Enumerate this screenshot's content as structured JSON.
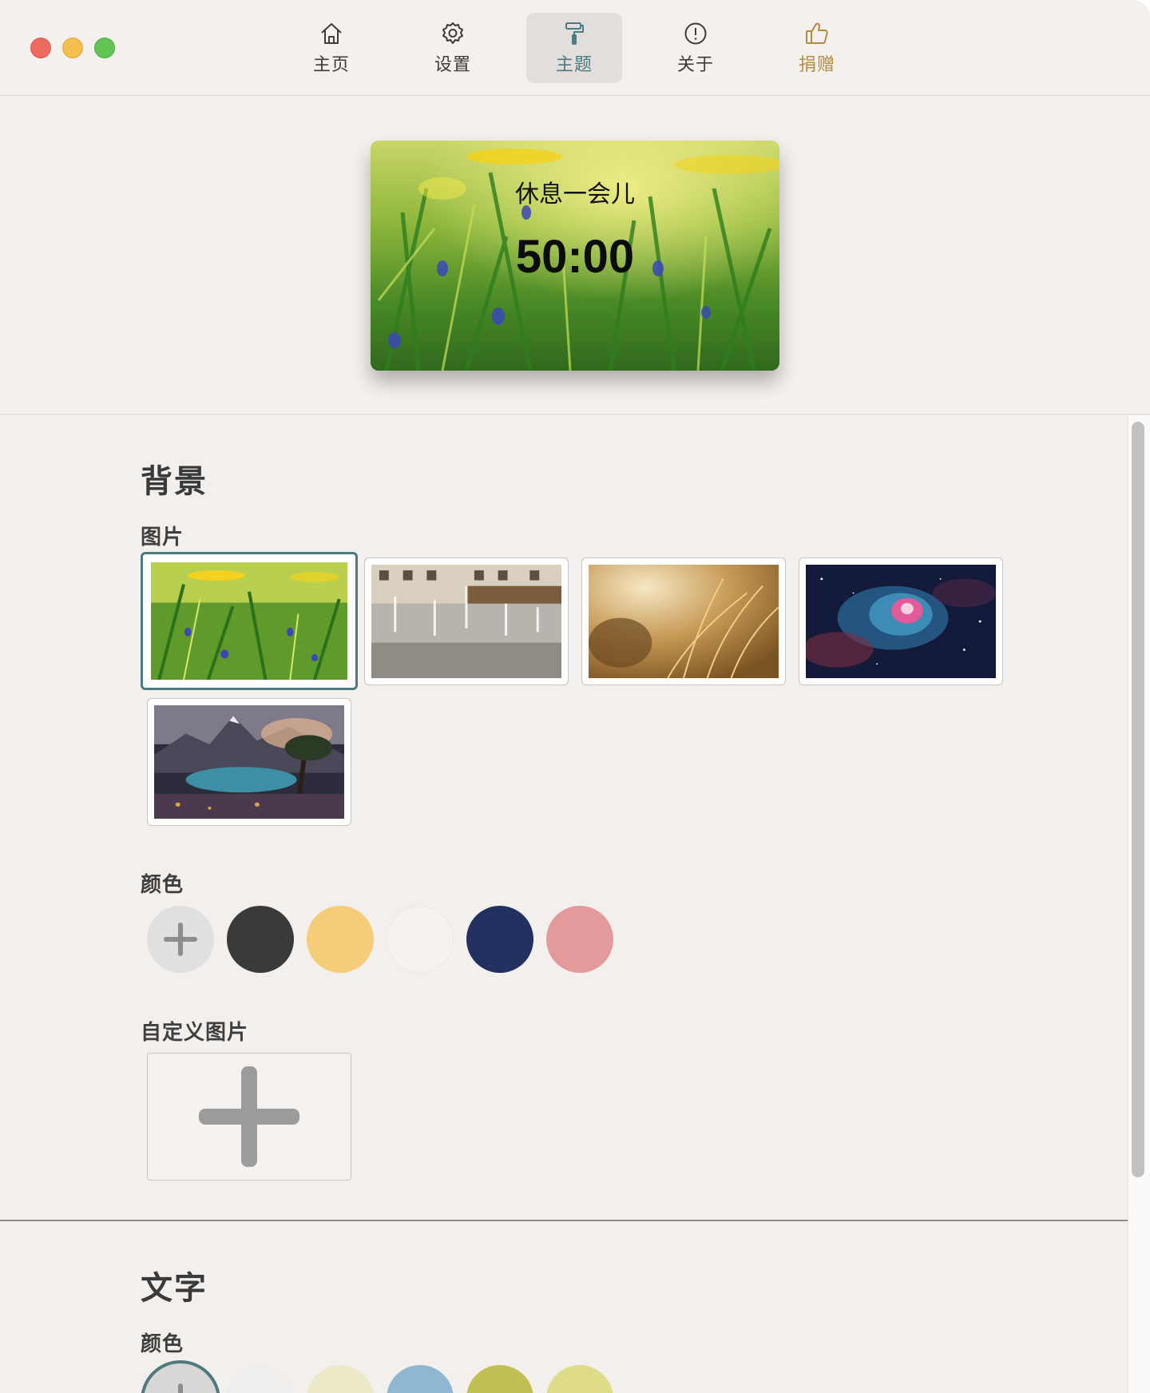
{
  "toolbar": {
    "tabs": [
      {
        "label": "主页",
        "icon": "home-icon"
      },
      {
        "label": "设置",
        "icon": "gear-icon"
      },
      {
        "label": "主题",
        "icon": "paint-roller-icon"
      },
      {
        "label": "关于",
        "icon": "info-icon"
      },
      {
        "label": "捐赠",
        "icon": "thumbs-up-icon"
      }
    ],
    "active_tab": "主题"
  },
  "preview": {
    "title": "休息一会儿",
    "time": "50:00",
    "background": "meadow-flowers"
  },
  "background_section": {
    "heading": "背景",
    "images_label": "图片",
    "images": [
      "meadow-flowers",
      "city-fountain",
      "golden-grass",
      "orion-nebula",
      "mountain-lake-tree"
    ],
    "selected_image": "meadow-flowers",
    "colors_label": "颜色",
    "colors": [
      "#3a3a3a",
      "#f5cd79",
      "#f6f3ef",
      "#233160",
      "#e49a9a"
    ],
    "custom_label": "自定义图片"
  },
  "text_section": {
    "heading": "文字",
    "colors_label": "颜色",
    "colors": [
      "#efeeec",
      "#ebe9c7",
      "#8fb6d2",
      "#c2bf52",
      "#dedc89"
    ]
  }
}
